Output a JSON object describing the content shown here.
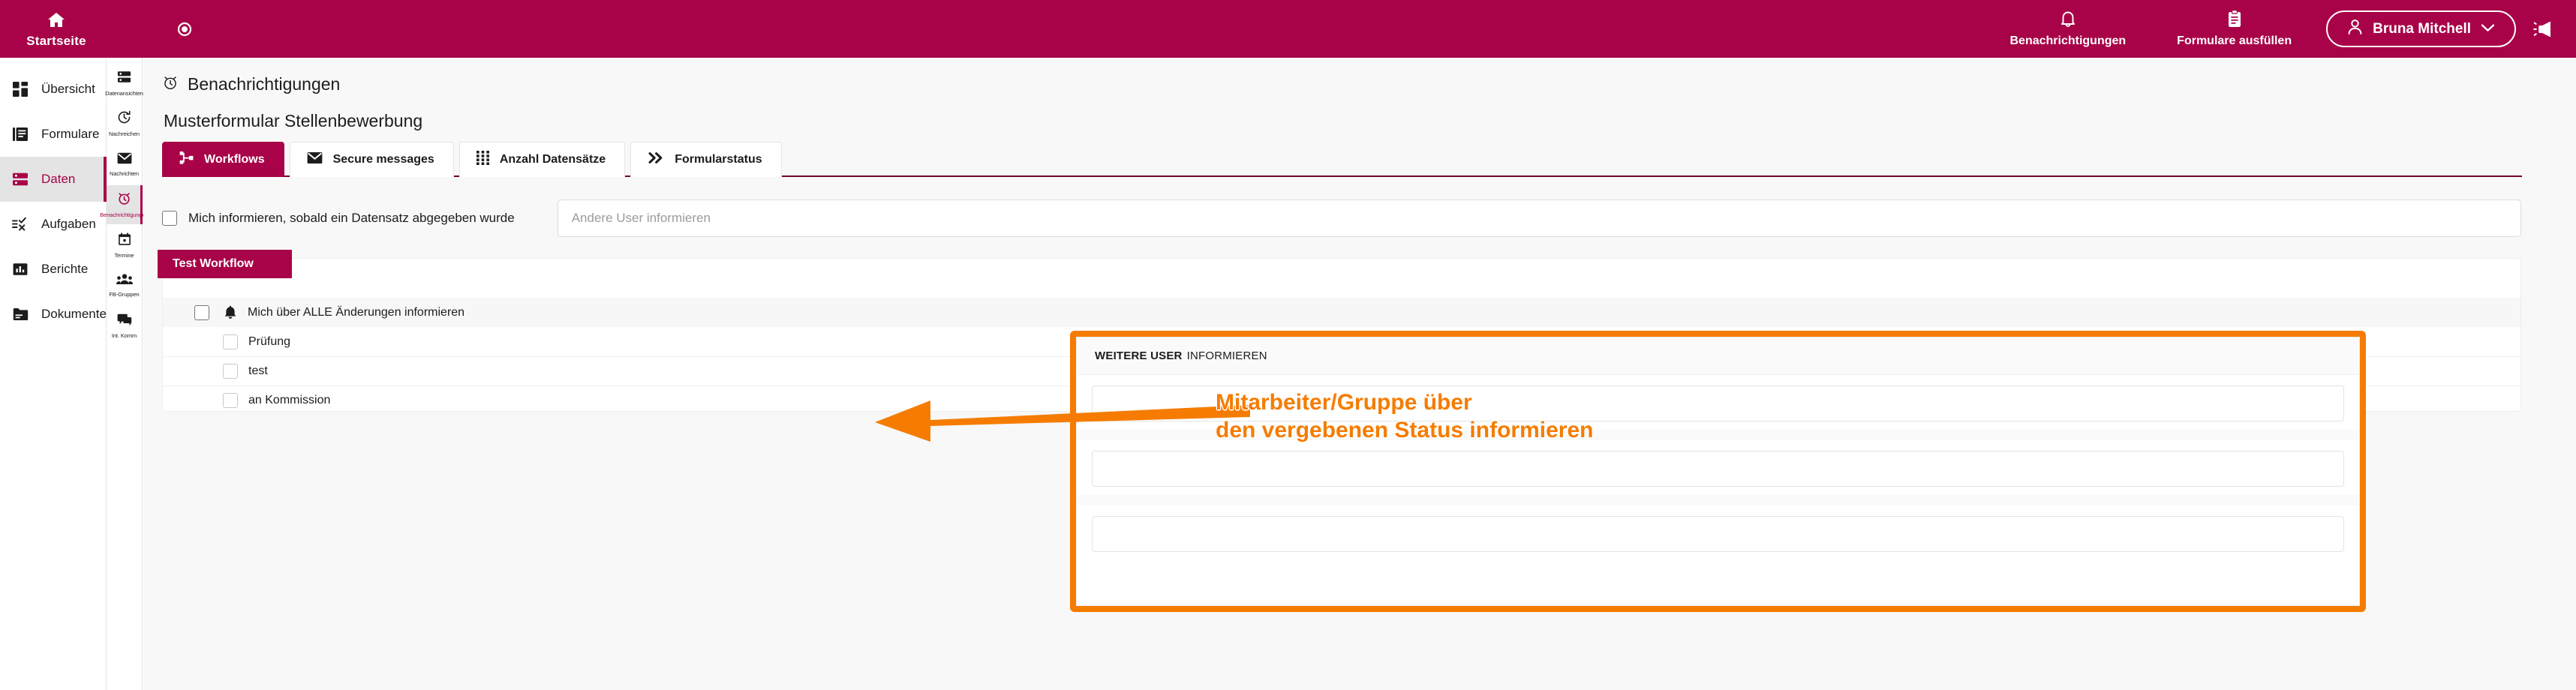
{
  "brand": {
    "primary": "#a80348",
    "accent_orange": "#f57c00",
    "badge_red": "#d61b00"
  },
  "topbar": {
    "home_label": "Startseite",
    "home_icon": "home-icon",
    "eye_icon": "eye-icon",
    "items": [
      {
        "label": "Benachrichtigungen",
        "icon": "bell-icon"
      },
      {
        "label": "Formulare ausfüllen",
        "icon": "clipboard-icon"
      }
    ],
    "user": {
      "name": "Bruna Mitchell",
      "icon": "user-icon",
      "caret": "chevron-down-icon"
    },
    "megaphone_icon": "megaphone-icon"
  },
  "sidebar": {
    "items": [
      {
        "label": "Übersicht",
        "icon": "dashboard-icon",
        "active": false,
        "badge": false
      },
      {
        "label": "Formulare",
        "icon": "forms-icon",
        "active": false,
        "badge": false
      },
      {
        "label": "Daten",
        "icon": "database-icon",
        "active": true,
        "badge": false
      },
      {
        "label": "Aufgaben",
        "icon": "tasks-icon",
        "active": false,
        "badge": true
      },
      {
        "label": "Berichte",
        "icon": "chart-icon",
        "active": false,
        "badge": false
      },
      {
        "label": "Dokumente",
        "icon": "folder-icon",
        "active": false,
        "badge": false
      }
    ]
  },
  "iconrail": {
    "items": [
      {
        "label": "Datenansichten",
        "icon": "database-icon",
        "active": false
      },
      {
        "label": "Nachreichen",
        "icon": "history-icon",
        "active": false
      },
      {
        "label": "Nachrichten",
        "icon": "envelope-icon",
        "active": false
      },
      {
        "label": "Benachrichtigungen",
        "icon": "alarm-icon",
        "active": true
      },
      {
        "label": "Termine",
        "icon": "calendar-icon",
        "active": false
      },
      {
        "label": "FB-Gruppen",
        "icon": "group-icon",
        "active": false
      },
      {
        "label": "Int. Komm",
        "icon": "chat-icon",
        "active": false
      }
    ]
  },
  "main": {
    "page_title": "Benachrichtigungen",
    "page_title_icon": "alarm-icon",
    "subtitle": "Musterformular Stellenbewerbung",
    "tabs": [
      {
        "label": "Workflows",
        "icon": "workflow-icon",
        "active": true
      },
      {
        "label": "Secure messages",
        "icon": "envelope-icon",
        "active": false
      },
      {
        "label": "Anzahl Datensätze",
        "icon": "grid-icon",
        "active": false
      },
      {
        "label": "Formularstatus",
        "icon": "double-chevron-right-icon",
        "active": false
      }
    ],
    "inform_row": {
      "checkbox_label": "Mich informieren, sobald ein Datensatz abgegeben wurde",
      "checkbox_checked": false,
      "input_placeholder": "Andere User informieren",
      "input_value": ""
    },
    "workflow": {
      "badge": "Test Workflow",
      "rows": [
        {
          "label": "Mich über ALLE Änderungen informieren",
          "checked": false,
          "icon": "bell-icon",
          "header": true
        },
        {
          "label": "Prüfung",
          "checked": false,
          "header": false
        },
        {
          "label": "test",
          "checked": false,
          "header": false
        },
        {
          "label": "an Kommission",
          "checked": false,
          "header": false
        }
      ]
    }
  },
  "annotation": {
    "panel_title_strong": "WEITERE USER",
    "panel_title_rest": "INFORMIEREN",
    "fields": [
      "",
      "",
      ""
    ],
    "callout_line1": "Mitarbeiter/Gruppe über",
    "callout_line2": "den vergebenen Status informieren",
    "arrow_icon": "left-arrow-icon"
  }
}
